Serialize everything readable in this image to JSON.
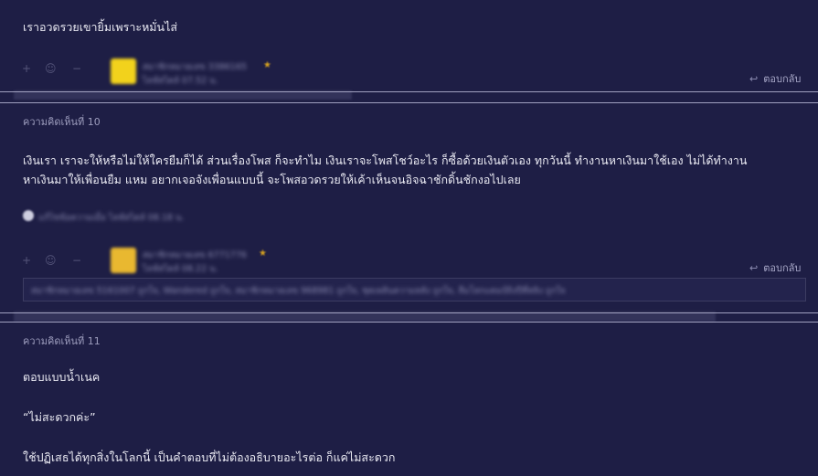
{
  "top_comment": {
    "text": "เราอวดรวยเขายิ้มเพราะหมั่นไส่"
  },
  "reply_label": "ตอบกลับ",
  "comments": [
    {
      "label": "ความคิดเห็นที่ 10",
      "paragraphs": [
        "เงินเรา เราจะให้หรือไม่ให้ใครยืมก็ได้ ส่วนเรื่องโพส ก็จะทำไม เงินเราจะโพสโชว์อะไร ก็ซื้อด้วยเงินตัวเอง ทุกวันนี้ ทำงานหาเงินมาใช้เอง ไม่ได้ทำงาน",
        "หาเงินมาให้เพื่อนยืม แหม อยากเจอจังเพื่อนแบบนี้ จะโพสอวดรวยให้เค้าเห็นจนอิจฉาชักดิ้นชักงอไปเลย"
      ]
    },
    {
      "label": "ความคิดเห็นที่ 11",
      "paragraphs": [
        "ตอบแบบน้ำเนค",
        "“ไม่สะดวกค่ะ”",
        "ใช้ปฏิเสธได้ทุกสิ่งในโลกนี้ เป็นคำตอบที่ไม่ต้องอธิบายอะไรต่อ ก็แค่ไม่สะดวก"
      ]
    }
  ],
  "blurred": {
    "member1": "สมาชิกหมายเลข 3386165",
    "time1": "ไลฟ์สไตล์ 07.52 น.",
    "member2": "สมาชิกหมายเลข 6771776",
    "time2": "ไลฟ์สไตล์ 08.22 น.",
    "edited": "แก้ไขข้อความเมื่อ ไลฟ์สไตล์ 08.18 น.",
    "tags": "สมาชิกหมายเลข 5161007 ถูกใจ, Wandered ถูกใจ, สมาชิกหมายเลข 968981 ถูกใจ, ชุดเพลินความหลัง ถูกใจ, ลืมโลกแคมป์ถิงปีที่สลิง ถูกใจ"
  },
  "colors": {
    "background": "#1e1e45",
    "separator": "#b9b9d6",
    "text": "#e9e9f2",
    "muted": "#9d9dbd",
    "avatar_yellow": "#f2d21c"
  },
  "icons": [
    "plus-icon",
    "minus-icon",
    "emoji-icon",
    "reply-arrow-icon",
    "star-icon",
    "avatar-icon"
  ]
}
